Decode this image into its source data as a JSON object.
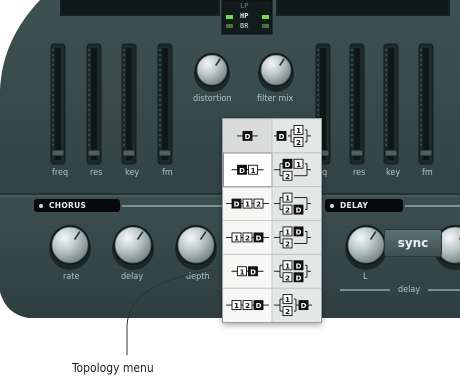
{
  "top_display": {
    "lines": [
      "LP",
      "HP",
      "BR"
    ]
  },
  "filter": {
    "slider_labels": [
      "freq",
      "res",
      "key",
      "fm"
    ],
    "right_slider_labels": [
      "q",
      "res",
      "key",
      "fm"
    ],
    "knobs": [
      {
        "label": "distortion"
      },
      {
        "label": "filter mix"
      }
    ]
  },
  "chorus": {
    "title": "CHORUS",
    "knobs": [
      {
        "label": "rate"
      },
      {
        "label": "delay"
      },
      {
        "label": "depth"
      }
    ]
  },
  "delay": {
    "title": "DELAY",
    "knob_label": "L",
    "group_label": "delay",
    "sync_label": "sync"
  },
  "topology_menu": {
    "selected_index": 1,
    "items_left": [
      [
        "D"
      ],
      [
        "D",
        "1"
      ],
      [
        "D",
        "1",
        "2"
      ],
      [
        "1",
        "2",
        "D"
      ],
      [
        "1",
        "D"
      ],
      [
        "1",
        "2",
        "D"
      ]
    ],
    "items_right": [
      {
        "lead": "D",
        "top": "1",
        "bottom": "2",
        "trail": ""
      },
      {
        "lead": "",
        "top": "D 1",
        "bottom": "2",
        "trail": ""
      },
      {
        "lead": "",
        "top": "1",
        "bottom": "2 D",
        "trail": ""
      },
      {
        "lead": "",
        "top": "1 D",
        "bottom": "2",
        "trail": ""
      },
      {
        "lead": "",
        "top": "1 D",
        "bottom": "2 D",
        "trail": ""
      },
      {
        "lead": "",
        "top": "1",
        "bottom": "2",
        "trail": "D"
      }
    ]
  },
  "callout": {
    "text": "Topology menu"
  },
  "colors": {
    "panel": "#3a4c4c",
    "menu_bg": "#f6f6f4",
    "selected_bg": "#ffffff",
    "accent_green": "#6fdc4e"
  }
}
